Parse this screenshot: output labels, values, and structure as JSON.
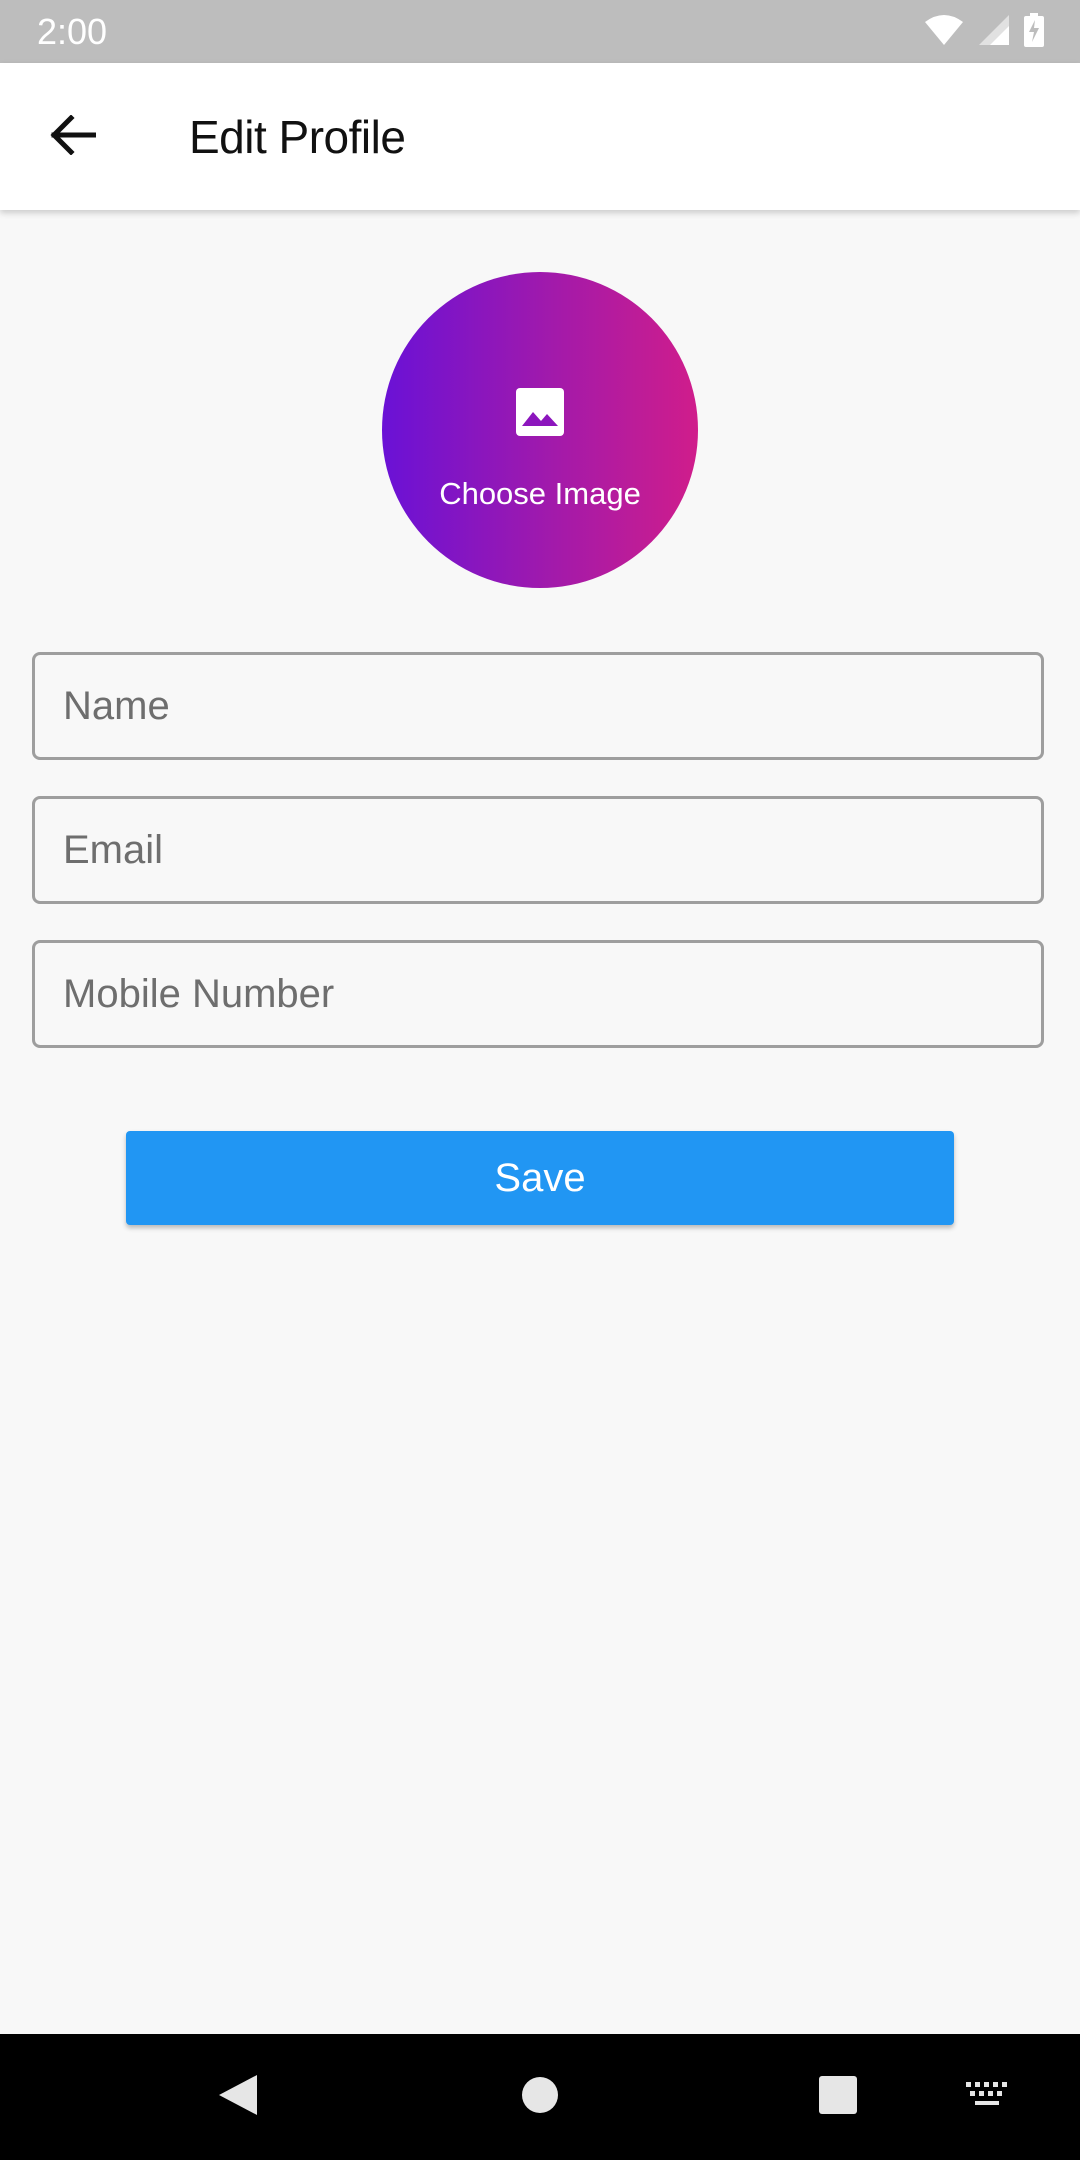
{
  "status_bar": {
    "time": "2:00",
    "icons": [
      "wifi-icon",
      "signal-icon",
      "battery-charging-icon"
    ]
  },
  "app_bar": {
    "back_icon": "arrow-left-icon",
    "title": "Edit Profile"
  },
  "avatar": {
    "icon": "image-icon",
    "label": "Choose Image",
    "gradient": [
      "#6a11d6",
      "#d01d8b"
    ]
  },
  "form": {
    "name": {
      "placeholder": "Name",
      "value": ""
    },
    "email": {
      "placeholder": "Email",
      "value": ""
    },
    "mobile": {
      "placeholder": "Mobile Number",
      "value": ""
    }
  },
  "save_button": {
    "label": "Save",
    "color": "#2196f3"
  },
  "nav_bar": {
    "buttons": [
      "back-triangle-icon",
      "home-circle-icon",
      "recents-square-icon",
      "keyboard-icon"
    ]
  }
}
